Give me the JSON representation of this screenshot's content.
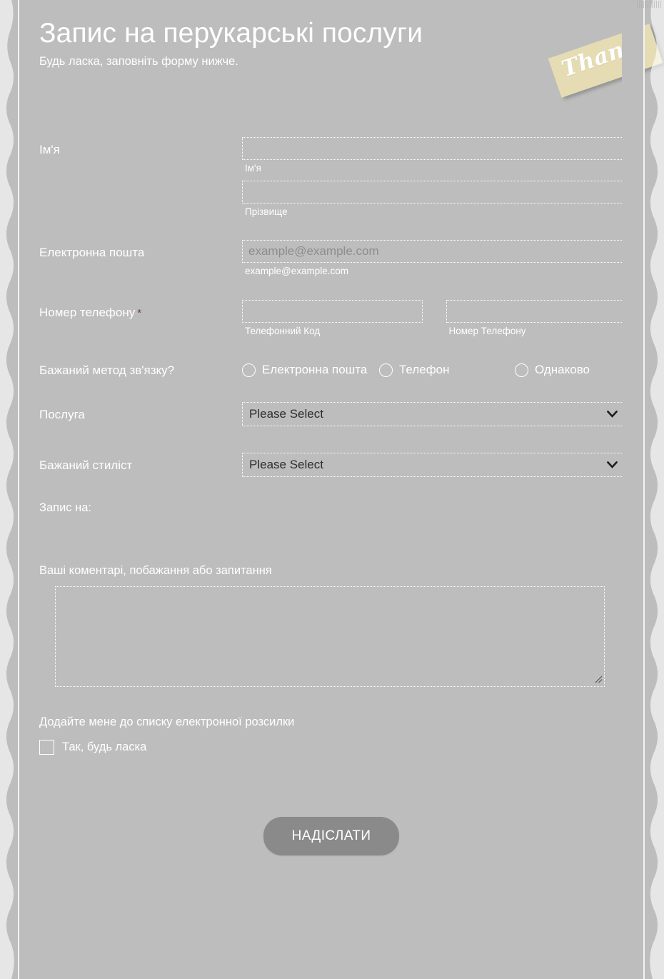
{
  "header": {
    "title": "Запис на перукарські послуги",
    "subtitle": "Будь ласка, заповніть форму нижче.",
    "tag_text": "Thank"
  },
  "fields": {
    "name": {
      "label": "Ім'я",
      "first_value": "",
      "first_placeholder": "",
      "first_sublabel": "Ім'я",
      "last_value": "",
      "last_placeholder": "",
      "last_sublabel": "Прізвище"
    },
    "email": {
      "label": "Електронна пошта",
      "value": "",
      "placeholder": "example@example.com",
      "sublabel": "example@example.com"
    },
    "phone": {
      "label": "Номер телефону",
      "required_mark": "*",
      "area_value": "",
      "area_sublabel": "Телефонний Код",
      "number_value": "",
      "number_sublabel": "Номер Телефону"
    },
    "contact_method": {
      "label": "Бажаний метод зв'язку?",
      "options": [
        {
          "label": "Електронна пошта",
          "selected": false
        },
        {
          "label": "Телефон",
          "selected": false
        },
        {
          "label": "Однаково",
          "selected": false
        }
      ]
    },
    "service": {
      "label": "Послуга",
      "selected": "Please Select",
      "options": [
        "Please Select"
      ]
    },
    "stylist": {
      "label": "Бажаний стиліст",
      "selected": "Please Select",
      "options": [
        "Please Select"
      ]
    },
    "appointment_for": {
      "label": "Запис на:"
    },
    "comments": {
      "label": "Ваші коментарі, побажання або запитання",
      "value": "",
      "placeholder": ""
    },
    "mailing_list": {
      "label": "Додайте мене до списку електронної розсилки",
      "checkbox_label": "Так, будь ласка",
      "checked": false
    }
  },
  "submit": {
    "label": "НАДІСЛАТИ"
  },
  "colors": {
    "background": "#bdbdbd",
    "text_on_background": "#ffffff",
    "tag_background": "#e5dcb4",
    "required_star": "#6b4040",
    "submit_background": "#8a8a8a",
    "input_text": "#2e2e2e"
  }
}
